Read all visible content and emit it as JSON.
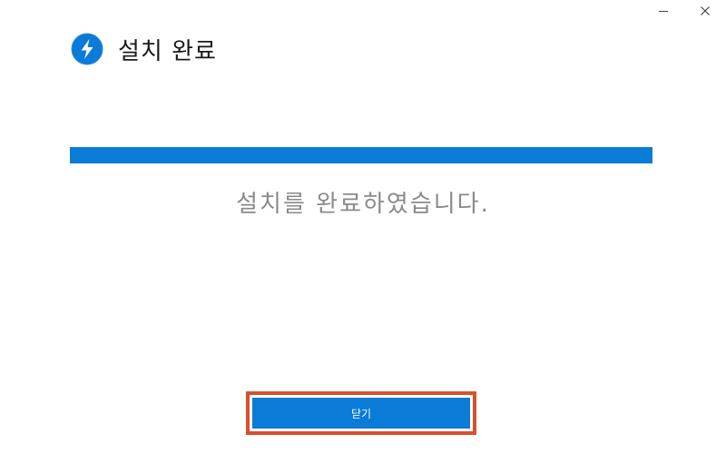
{
  "window": {
    "controls": {
      "minimize_icon": "minimize-icon",
      "close_icon": "close-icon"
    }
  },
  "header": {
    "icon": "lightning-bolt-icon",
    "title": "설치 완료"
  },
  "progress": {
    "value": 100,
    "color": "#0a7bd6"
  },
  "status": {
    "message": "설치를 완료하였습니다."
  },
  "footer": {
    "close_label": "닫기",
    "highlight_color": "#d9502e"
  }
}
